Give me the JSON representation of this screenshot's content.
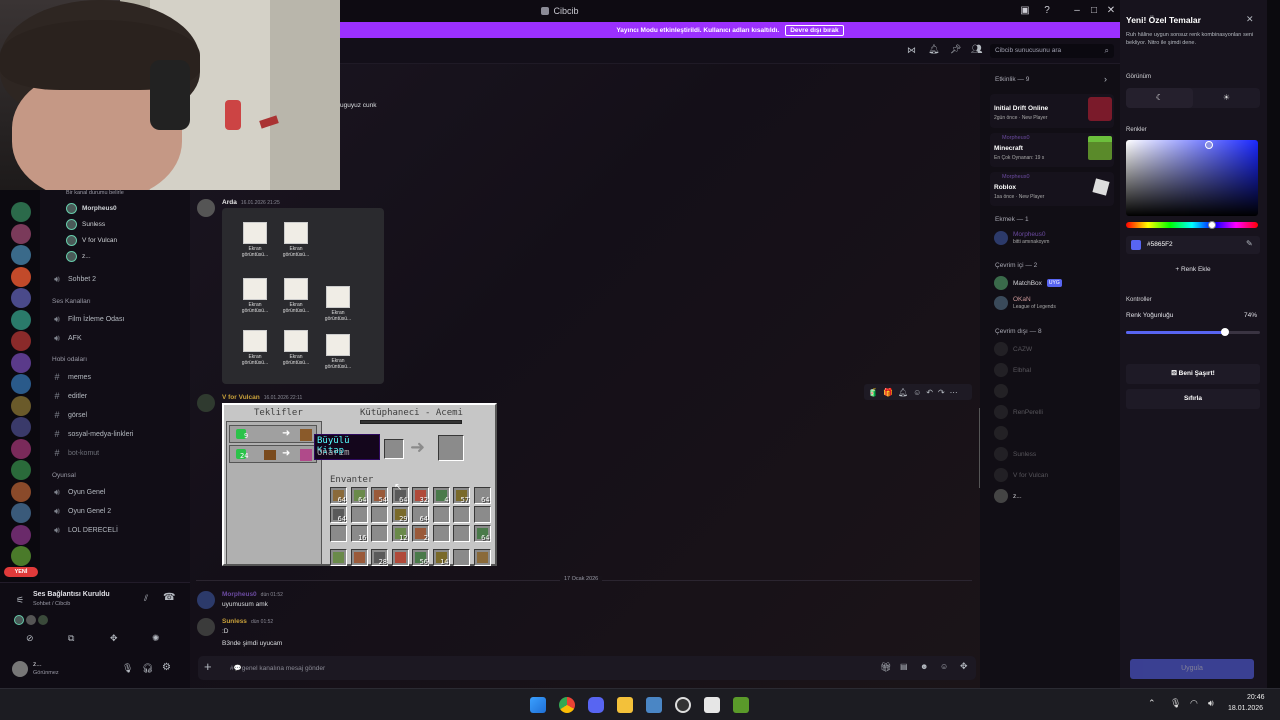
{
  "window": {
    "title": "Cibcib"
  },
  "banner": {
    "text": "Yayıncı Modu etkinleştirildi. Kullanıcı adları kısaltıldı.",
    "button": "Devre dışı bırak"
  },
  "search": {
    "placeholder": "Cibcib sunucusunu ara"
  },
  "chat_top": {
    "partial_text": "uguyuz cunk"
  },
  "channels": {
    "voice_hint": "Bir kanal durumu belirle",
    "voice_users": [
      "Morpheus0",
      "Sunless",
      "V for Vulcan",
      "z..."
    ],
    "sohbet2": "Sohbet 2",
    "ses_kanallari": "Ses Kanalları",
    "film": "Film İzleme Odası",
    "afk": "AFK",
    "hobi": "Hobi odaları",
    "memes": "memes",
    "editler": "editler",
    "gorsel": "görsel",
    "sosyal": "sosyal-medya-linkleri",
    "bot": "bot-komut",
    "oyunsal": "Oyunsal",
    "oyun_genel": "Oyun Genel",
    "oyun_genel2": "Oyun Genel 2",
    "lol": "LOL DERECELİ"
  },
  "voice": {
    "status": "Ses Bağlantısı Kuruldu",
    "channel": "Sohbet / Cibcib",
    "user": "z...",
    "user_status": "Görünmez"
  },
  "server_badge": "YENİ",
  "messages": [
    {
      "user": "Arda",
      "time": "16.01.2026 21:25"
    },
    {
      "user": "V for Vulcan",
      "time": "16.01.2026 22:11"
    },
    {
      "user": "Morpheus0",
      "time": "dün 01:52",
      "text": "uyumusum amk"
    },
    {
      "user": "Sunless",
      "time": "dün 01:52",
      "text": ":D",
      "text2": "B3nde şimdi uyucam"
    }
  ],
  "files": [
    "Ekran görüntüsü...",
    "Ekran görüntüsü...",
    "Ekran görüntüsü...",
    "Ekran görüntüsü...",
    "Ekran görüntüsü...",
    "Ekran görüntüsü...",
    "Ekran görüntüsü...",
    "Ekran görüntüsü..."
  ],
  "minecraft": {
    "offers": "Teklifler",
    "title": "Kütüphaneci - Acemi",
    "inventory": "Envanter",
    "tooltip_title": "Büyülü Kitap",
    "tooltip_sub": "Onarım",
    "trade1_count": "9",
    "trade2_count": "24",
    "counts_row1": [
      "64",
      "64",
      "54",
      "64",
      "32",
      "4",
      "57",
      "64"
    ],
    "counts_row2": [
      "64",
      "",
      "",
      "29",
      "64",
      "",
      "",
      ""
    ],
    "counts_row3": [
      "",
      "16",
      "",
      "12",
      "2",
      "",
      "",
      "64"
    ],
    "counts_hotbar": [
      "",
      "",
      "28",
      "",
      "56",
      "14",
      "",
      ""
    ]
  },
  "date_divider": "17 Ocak 2026",
  "composer": {
    "placeholder": "#💬genel kanalına mesaj gönder"
  },
  "members": {
    "activity_header": "Etkinlik — 9",
    "activities": [
      {
        "user": "",
        "game": "Initial Drift Online",
        "meta": "2gün önce",
        "tag": "New Player"
      },
      {
        "user": "Morpheus0",
        "game": "Minecraft",
        "meta": "En Çok Oynanan: 19 s",
        "tag": ""
      },
      {
        "user": "Morpheus0",
        "game": "Roblox",
        "meta": "1sa önce",
        "tag": "New Player"
      }
    ],
    "ekmek_header": "Ekmek — 1",
    "ekmek_user": "Morpheus0",
    "ekmek_status": "bitti amınakoyım",
    "online_header": "Çevrim içi — 2",
    "online": [
      {
        "name": "MatchBox",
        "badge": "UYG"
      },
      {
        "name": "OKaN",
        "status": "League of Legends"
      }
    ],
    "offline_header": "Çevrim dışı — 8",
    "offline": [
      "CAZW",
      "Elbhal",
      "",
      "RenPerelli",
      "",
      "Sunless",
      "V for Vulcan",
      "z..."
    ]
  },
  "panel": {
    "title": "Yeni! Özel Temalar",
    "desc": "Ruh hâline uygun sonsuz renk kombinasyonları seni bekliyor. Nitro ile şimdi dene.",
    "appearance": "Görünüm",
    "colors": "Renkler",
    "hex": "#5865F2",
    "add_color": "Renk Ekle",
    "controls": "Kontroller",
    "intensity_label": "Renk Yoğunluğu",
    "intensity_value": "74%",
    "intensity": 0.74,
    "surprise": "Beni Şaşırt!",
    "reset": "Sıfırla",
    "apply": "Uygula",
    "accent": "#5865F2"
  },
  "taskbar": {
    "time": "20:46",
    "date": "18.01.2026"
  }
}
